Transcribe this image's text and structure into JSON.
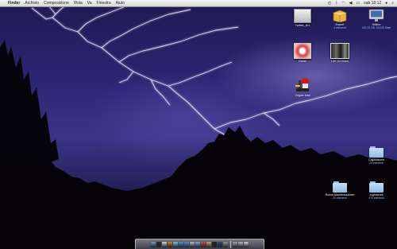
{
  "menubar": {
    "apple_symbol": "",
    "items": [
      "Finder",
      "Archivio",
      "Composizione",
      "Vista",
      "Va",
      "Finestra",
      "Aiuto"
    ],
    "clock": "sab 18:12"
  },
  "desktop_icons": {
    "twitter_bg": {
      "name": "Twitter_BG",
      "sub": ""
    },
    "export": {
      "name": "Export",
      "sub": "4 elementi"
    },
    "volume": {
      "name": "Ifollico",
      "sub": "470,76 GB, 315,53 liberi"
    },
    "gmail": {
      "name": "Gmail",
      "sub": ""
    },
    "life_on_mars": {
      "name": "Life On Mars",
      "sub": ""
    },
    "virgilio": {
      "name": "Virgilio Mail",
      "sub": ""
    },
    "capodanno": {
      "name": "Capodanno",
      "sub": "25 elementi"
    },
    "roma": {
      "name": "Roma Manifestazione",
      "sub": "25 elementi"
    },
    "inghilterra": {
      "name": "Inghilterra",
      "sub": "475 elementi"
    }
  },
  "dock": {
    "items": [
      "finder-icon",
      "dashboard-icon",
      "mail-icon",
      "firefox-icon",
      "itunes-icon",
      "skype-icon",
      "ichat-icon",
      "iphoto-icon",
      "preview-icon",
      "calendar-icon",
      "addressbook-icon",
      "terminal-icon",
      "photoshop-icon",
      "system-prefs-icon",
      "downloads-stack-icon",
      "documents-stack-icon",
      "trash-icon"
    ],
    "colors": [
      "#5fa0e0",
      "#2b2b2b",
      "#cfd8e6",
      "#e8782a",
      "#6fc4f0",
      "#2ea6e0",
      "#4f8fe0",
      "#b0c0d0",
      "#7aaee8",
      "#d84a3a",
      "#c8a870",
      "#222222",
      "#1a4c86",
      "#9a9a9a",
      "#a0a8b8",
      "#b8b8c0",
      "#cfcfd6"
    ]
  },
  "colors": {
    "sky": "#2b2470",
    "menubar": "#e6e6e6",
    "folder": "#a9cdef",
    "sub_label": "#8cc2ff"
  }
}
